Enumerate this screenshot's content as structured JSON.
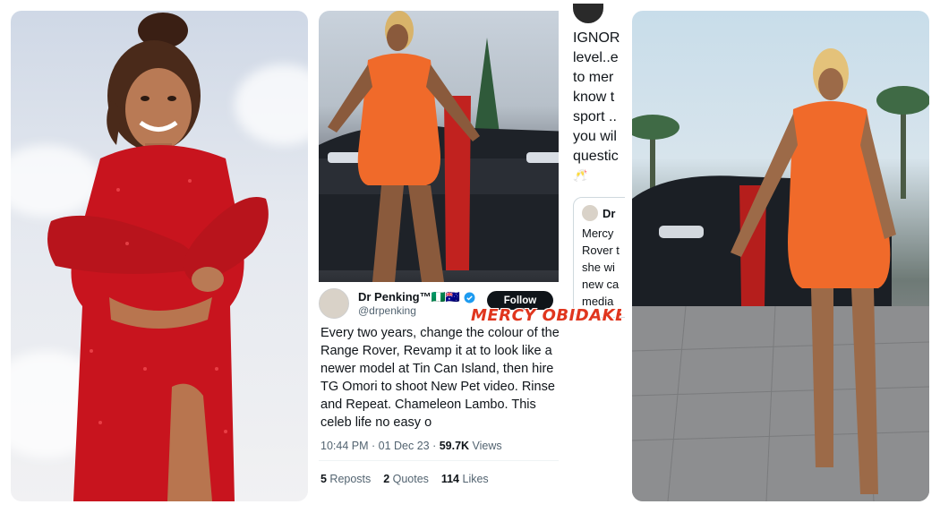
{
  "panel_tweet": {
    "author_name": "Dr Penking™🇳🇬🇦🇺",
    "author_handle": "@drpenking",
    "follow_label": "Follow",
    "verified_icon": "verified-badge-icon",
    "text": "Every two years, change the colour of the Range Rover, Revamp it at to look like a newer model at Tin Can Island, then hire TG Omori to shoot New Pet video. Rinse and Repeat. Chameleon Lambo. This celeb life no easy o",
    "time": "10:44 PM · 01 Dec 23 · ",
    "views_count": "59.7K",
    "views_label": " Views",
    "reposts_count": "5",
    "reposts_label": " Reposts",
    "quotes_count": "2",
    "quotes_label": " Quotes",
    "likes_count": "114",
    "likes_label": " Likes"
  },
  "watermark": "MERCY OBIDAKE",
  "cropped_panel": {
    "lines": [
      "IGNOR",
      "level..e",
      "to  mer",
      "know t",
      "sport ..",
      "you wil",
      "questic"
    ],
    "emoji": "🥂",
    "quoted_name": "Dr",
    "quoted_lines": [
      "Mercy",
      "Rover t",
      "she wi",
      "new ca",
      "media"
    ]
  },
  "colors": {
    "dress_red": "#c8141e",
    "orange_dress": "#f06a2a",
    "accent_red": "#e0361e",
    "verified_blue": "#1d9bf0"
  }
}
